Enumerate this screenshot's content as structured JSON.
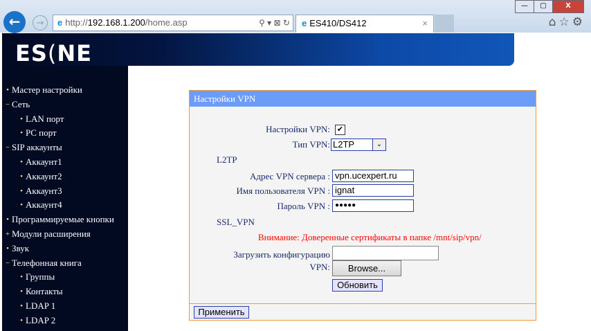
{
  "browser": {
    "url_prefix": "http://",
    "url_host": "192.168.1.200",
    "url_path": "/home.asp",
    "tab_title": "ES410/DS412",
    "tab_close": "×",
    "back": "←",
    "forward": "→",
    "toolbar_icons": "⌂☆⚙",
    "addr_tools": "⚲ ▾ ⊠ ↻",
    "win_min": "—",
    "win_max": "▢",
    "win_close": "X"
  },
  "logo": "ESCENE",
  "sidebar": {
    "items": [
      {
        "label": "Мастер настройки",
        "bullet": "•",
        "sub": false
      },
      {
        "label": "Сеть",
        "bullet": "−",
        "sub": false
      },
      {
        "label": "LAN порт",
        "bullet": "•",
        "sub": true
      },
      {
        "label": "PC порт",
        "bullet": "•",
        "sub": true
      },
      {
        "label": "SIP аккаунты",
        "bullet": "−",
        "sub": false
      },
      {
        "label": "Аккаунт1",
        "bullet": "•",
        "sub": true
      },
      {
        "label": "Аккаунт2",
        "bullet": "•",
        "sub": true
      },
      {
        "label": "Аккаунт3",
        "bullet": "•",
        "sub": true
      },
      {
        "label": "Аккаунт4",
        "bullet": "•",
        "sub": true
      },
      {
        "label": "Программируемые кнопки",
        "bullet": "•",
        "sub": false
      },
      {
        "label": "Модули расширения",
        "bullet": "+",
        "sub": false
      },
      {
        "label": "Звук",
        "bullet": "•",
        "sub": false
      },
      {
        "label": "Телефонная книга",
        "bullet": "−",
        "sub": false
      },
      {
        "label": "Группы",
        "bullet": "•",
        "sub": true
      },
      {
        "label": "Контакты",
        "bullet": "•",
        "sub": true
      },
      {
        "label": "LDAP 1",
        "bullet": "•",
        "sub": true
      },
      {
        "label": "LDAP 2",
        "bullet": "•",
        "sub": true
      }
    ]
  },
  "panel": {
    "title": "Настройки VPN",
    "vpn_enable_label": "Настройки VPN:",
    "vpn_enable_checked": "✔",
    "vpn_type_label": "Тип VPN:",
    "vpn_type_value": "L2TP",
    "select_arrow": "⌄",
    "l2tp_heading": "L2TP",
    "server_label": "Адрес VPN сервера :",
    "server_value": "vpn.ucexpert.ru",
    "user_label": "Имя пользователя VPN :",
    "user_value": "ignat",
    "password_label": "Пароль VPN :",
    "password_value": "●●●●●",
    "ssl_heading": "SSL_VPN",
    "warning": "Внимание: Доверенные сертификаты в папке /mnt/sip/vpn/",
    "upload_label_1": "Загрузить конфигурацию",
    "upload_label_2": "VPN:",
    "browse": "Browse...",
    "update": "Обновить",
    "apply": "Применить"
  }
}
